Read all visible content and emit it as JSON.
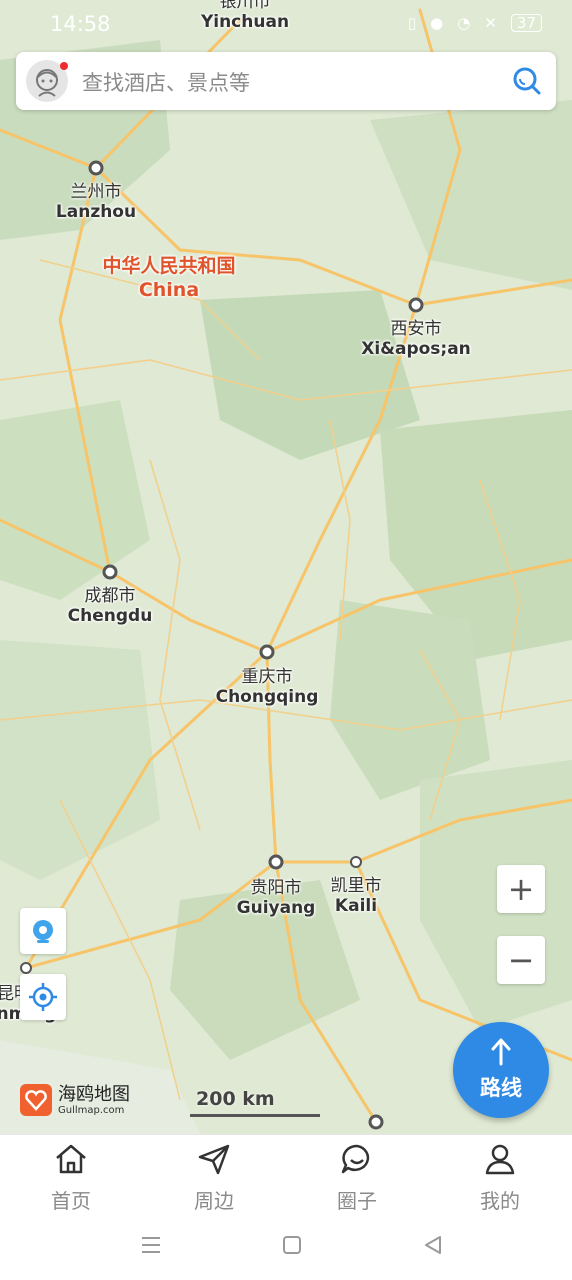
{
  "status": {
    "time": "14:58",
    "battery": "37"
  },
  "search": {
    "placeholder": "查找酒店、景点等"
  },
  "map": {
    "country": {
      "zh": "中华人民共和国",
      "en": "China"
    },
    "cities": [
      {
        "id": "yinchuan",
        "zh": "银川市",
        "en": "Yinchuan"
      },
      {
        "id": "lanzhou",
        "zh": "兰州市",
        "en": "Lanzhou"
      },
      {
        "id": "xian",
        "zh": "西安市",
        "en": "Xi&apos;an"
      },
      {
        "id": "chengdu",
        "zh": "成都市",
        "en": "Chengdu"
      },
      {
        "id": "chongqing",
        "zh": "重庆市",
        "en": "Chongqing"
      },
      {
        "id": "guiyang",
        "zh": "贵阳市",
        "en": "Guiyang"
      },
      {
        "id": "kaili",
        "zh": "凯里市",
        "en": "Kaili"
      },
      {
        "id": "kunming",
        "zh": "昆明",
        "en": "Kunming"
      }
    ],
    "scale": "200 km",
    "zoom_in": "+",
    "zoom_out": "−",
    "route_label": "路线",
    "brand": {
      "name": "海鸥地图",
      "url": "Gullmap.com"
    }
  },
  "nav": {
    "items": [
      {
        "label": "首页",
        "icon": "home-icon"
      },
      {
        "label": "周边",
        "icon": "send-icon"
      },
      {
        "label": "圈子",
        "icon": "chat-icon"
      },
      {
        "label": "我的",
        "icon": "user-icon"
      }
    ]
  },
  "colors": {
    "road": "#f7c469",
    "land": "#dfe9d3",
    "accent": "#2f8ae5",
    "country": "#e0542c"
  }
}
